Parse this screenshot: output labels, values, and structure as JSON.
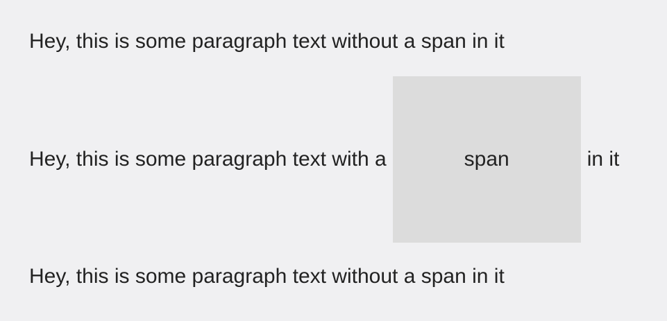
{
  "paragraphs": [
    {
      "text": "Hey, this is some paragraph text without a span in it"
    },
    {
      "before": "Hey, this is some paragraph text with a",
      "span": "span",
      "after": "in it"
    },
    {
      "text": "Hey, this is some paragraph text without a span in it"
    }
  ],
  "colors": {
    "background": "#f0f0f2",
    "span_background": "#dcdcdc",
    "text": "#222222"
  }
}
